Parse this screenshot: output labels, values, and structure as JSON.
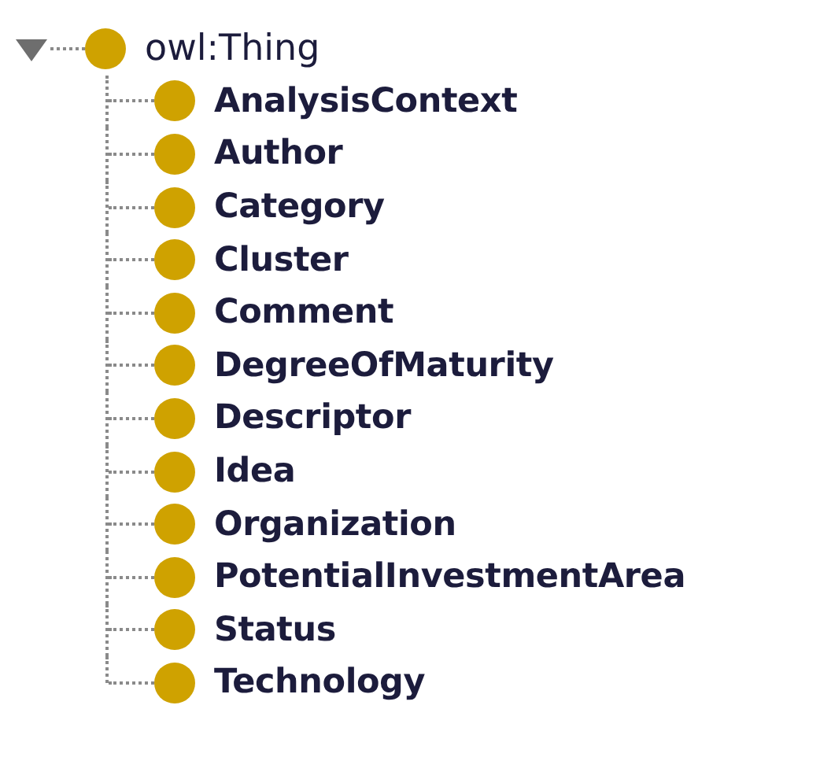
{
  "tree": {
    "label": "owl:Thing",
    "expanded": true,
    "children": [
      {
        "label": "AnalysisContext"
      },
      {
        "label": "Author"
      },
      {
        "label": "Category"
      },
      {
        "label": "Cluster"
      },
      {
        "label": "Comment"
      },
      {
        "label": "DegreeOfMaturity"
      },
      {
        "label": "Descriptor"
      },
      {
        "label": "Idea"
      },
      {
        "label": "Organization"
      },
      {
        "label": "PotentialInvestmentArea"
      },
      {
        "label": "Status"
      },
      {
        "label": "Technology"
      }
    ]
  }
}
